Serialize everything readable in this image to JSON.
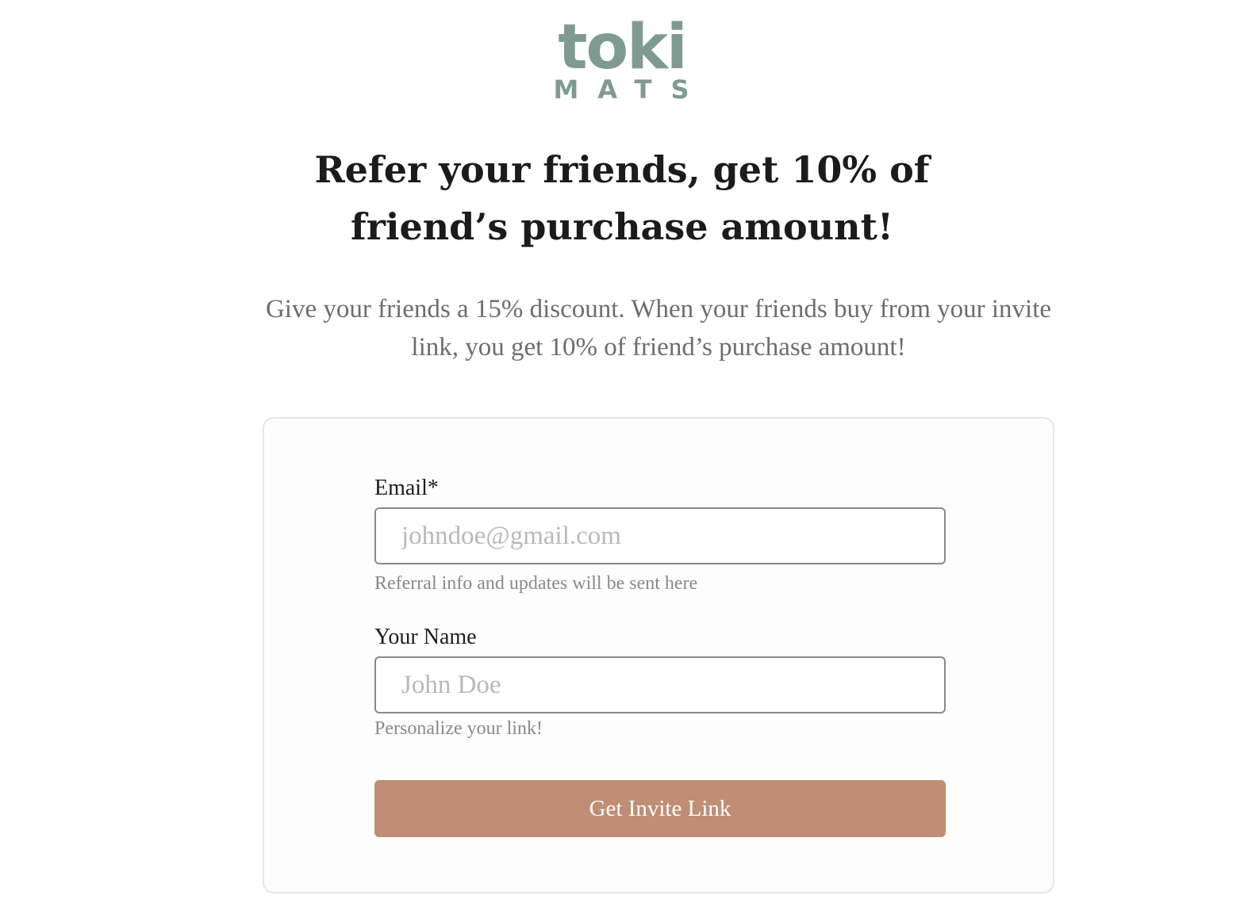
{
  "brand": {
    "logo_word": "toki",
    "logo_subword": "MATS",
    "logo_color": "#7f9a92"
  },
  "headline": "Refer your friends, get 10% of friend’s purchase amount!",
  "subtext": "Give your friends a 15% discount. When your friends buy from your invite link, you get 10% of friend’s purchase amount!",
  "form": {
    "email": {
      "label": "Email*",
      "placeholder": "johndoe@gmail.com",
      "value": "",
      "hint": "Referral info and updates will be sent here"
    },
    "name": {
      "label": "Your Name",
      "placeholder": "John Doe",
      "value": "",
      "hint": "Personalize your link!"
    },
    "submit_label": "Get Invite Link",
    "submit_color": "#bf8e75"
  }
}
